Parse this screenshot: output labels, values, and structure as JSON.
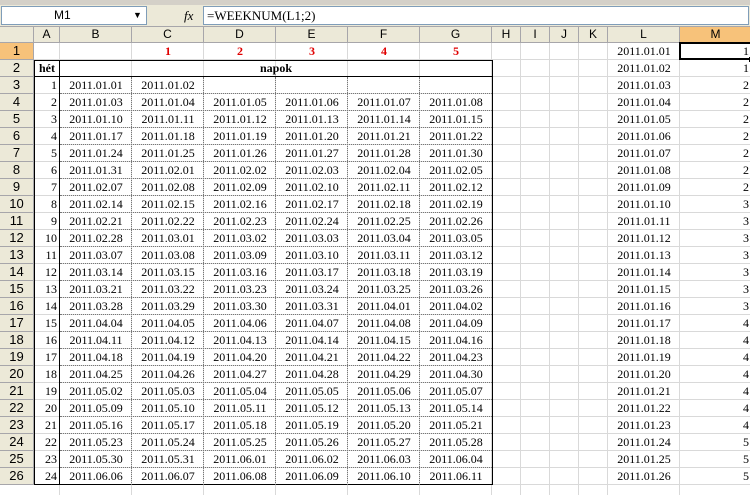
{
  "formula_bar": {
    "name_box": "M1",
    "fx_label": "fx",
    "formula": "=WEEKNUM(L1;2)"
  },
  "columns": [
    "A",
    "B",
    "C",
    "D",
    "E",
    "F",
    "G",
    "H",
    "I",
    "J",
    "K",
    "L",
    "M"
  ],
  "selected_cell": "M1",
  "row1_headers": {
    "C": "1",
    "D": "2",
    "E": "3",
    "F": "4",
    "G": "5"
  },
  "row2": {
    "A": "hét",
    "merged_label": "napok"
  },
  "rows": [
    {
      "row": 3,
      "A": "1",
      "B": "2011.01.01",
      "C": "2011.01.02",
      "D": "",
      "E": "",
      "F": "",
      "G": ""
    },
    {
      "row": 4,
      "A": "2",
      "B": "2011.01.03",
      "C": "2011.01.04",
      "D": "2011.01.05",
      "E": "2011.01.06",
      "F": "2011.01.07",
      "G": "2011.01.08"
    },
    {
      "row": 5,
      "A": "3",
      "B": "2011.01.10",
      "C": "2011.01.11",
      "D": "2011.01.12",
      "E": "2011.01.13",
      "F": "2011.01.14",
      "G": "2011.01.15"
    },
    {
      "row": 6,
      "A": "4",
      "B": "2011.01.17",
      "C": "2011.01.18",
      "D": "2011.01.19",
      "E": "2011.01.20",
      "F": "2011.01.21",
      "G": "2011.01.22"
    },
    {
      "row": 7,
      "A": "5",
      "B": "2011.01.24",
      "C": "2011.01.25",
      "D": "2011.01.26",
      "E": "2011.01.27",
      "F": "2011.01.28",
      "G": "2011.01.30"
    },
    {
      "row": 8,
      "A": "6",
      "B": "2011.01.31",
      "C": "2011.02.01",
      "D": "2011.02.02",
      "E": "2011.02.03",
      "F": "2011.02.04",
      "G": "2011.02.05"
    },
    {
      "row": 9,
      "A": "7",
      "B": "2011.02.07",
      "C": "2011.02.08",
      "D": "2011.02.09",
      "E": "2011.02.10",
      "F": "2011.02.11",
      "G": "2011.02.12"
    },
    {
      "row": 10,
      "A": "8",
      "B": "2011.02.14",
      "C": "2011.02.15",
      "D": "2011.02.16",
      "E": "2011.02.17",
      "F": "2011.02.18",
      "G": "2011.02.19"
    },
    {
      "row": 11,
      "A": "9",
      "B": "2011.02.21",
      "C": "2011.02.22",
      "D": "2011.02.23",
      "E": "2011.02.24",
      "F": "2011.02.25",
      "G": "2011.02.26"
    },
    {
      "row": 12,
      "A": "10",
      "B": "2011.02.28",
      "C": "2011.03.01",
      "D": "2011.03.02",
      "E": "2011.03.03",
      "F": "2011.03.04",
      "G": "2011.03.05"
    },
    {
      "row": 13,
      "A": "11",
      "B": "2011.03.07",
      "C": "2011.03.08",
      "D": "2011.03.09",
      "E": "2011.03.10",
      "F": "2011.03.11",
      "G": "2011.03.12"
    },
    {
      "row": 14,
      "A": "12",
      "B": "2011.03.14",
      "C": "2011.03.15",
      "D": "2011.03.16",
      "E": "2011.03.17",
      "F": "2011.03.18",
      "G": "2011.03.19"
    },
    {
      "row": 15,
      "A": "13",
      "B": "2011.03.21",
      "C": "2011.03.22",
      "D": "2011.03.23",
      "E": "2011.03.24",
      "F": "2011.03.25",
      "G": "2011.03.26"
    },
    {
      "row": 16,
      "A": "14",
      "B": "2011.03.28",
      "C": "2011.03.29",
      "D": "2011.03.30",
      "E": "2011.03.31",
      "F": "2011.04.01",
      "G": "2011.04.02"
    },
    {
      "row": 17,
      "A": "15",
      "B": "2011.04.04",
      "C": "2011.04.05",
      "D": "2011.04.06",
      "E": "2011.04.07",
      "F": "2011.04.08",
      "G": "2011.04.09"
    },
    {
      "row": 18,
      "A": "16",
      "B": "2011.04.11",
      "C": "2011.04.12",
      "D": "2011.04.13",
      "E": "2011.04.14",
      "F": "2011.04.15",
      "G": "2011.04.16"
    },
    {
      "row": 19,
      "A": "17",
      "B": "2011.04.18",
      "C": "2011.04.19",
      "D": "2011.04.20",
      "E": "2011.04.21",
      "F": "2011.04.22",
      "G": "2011.04.23"
    },
    {
      "row": 20,
      "A": "18",
      "B": "2011.04.25",
      "C": "2011.04.26",
      "D": "2011.04.27",
      "E": "2011.04.28",
      "F": "2011.04.29",
      "G": "2011.04.30"
    },
    {
      "row": 21,
      "A": "19",
      "B": "2011.05.02",
      "C": "2011.05.03",
      "D": "2011.05.04",
      "E": "2011.05.05",
      "F": "2011.05.06",
      "G": "2011.05.07"
    },
    {
      "row": 22,
      "A": "20",
      "B": "2011.05.09",
      "C": "2011.05.10",
      "D": "2011.05.11",
      "E": "2011.05.12",
      "F": "2011.05.13",
      "G": "2011.05.14"
    },
    {
      "row": 23,
      "A": "21",
      "B": "2011.05.16",
      "C": "2011.05.17",
      "D": "2011.05.18",
      "E": "2011.05.19",
      "F": "2011.05.20",
      "G": "2011.05.21"
    },
    {
      "row": 24,
      "A": "22",
      "B": "2011.05.23",
      "C": "2011.05.24",
      "D": "2011.05.25",
      "E": "2011.05.26",
      "F": "2011.05.27",
      "G": "2011.05.28"
    },
    {
      "row": 25,
      "A": "23",
      "B": "2011.05.30",
      "C": "2011.05.31",
      "D": "2011.06.01",
      "E": "2011.06.02",
      "F": "2011.06.03",
      "G": "2011.06.04"
    },
    {
      "row": 26,
      "A": "24",
      "B": "2011.06.06",
      "C": "2011.06.07",
      "D": "2011.06.08",
      "E": "2011.06.09",
      "F": "2011.06.10",
      "G": "2011.06.11"
    }
  ],
  "side_rows": [
    {
      "row": 1,
      "L": "2011.01.01",
      "M": "1"
    },
    {
      "row": 2,
      "L": "2011.01.02",
      "M": "1"
    },
    {
      "row": 3,
      "L": "2011.01.03",
      "M": "2"
    },
    {
      "row": 4,
      "L": "2011.01.04",
      "M": "2"
    },
    {
      "row": 5,
      "L": "2011.01.05",
      "M": "2"
    },
    {
      "row": 6,
      "L": "2011.01.06",
      "M": "2"
    },
    {
      "row": 7,
      "L": "2011.01.07",
      "M": "2"
    },
    {
      "row": 8,
      "L": "2011.01.08",
      "M": "2"
    },
    {
      "row": 9,
      "L": "2011.01.09",
      "M": "2"
    },
    {
      "row": 10,
      "L": "2011.01.10",
      "M": "3"
    },
    {
      "row": 11,
      "L": "2011.01.11",
      "M": "3"
    },
    {
      "row": 12,
      "L": "2011.01.12",
      "M": "3"
    },
    {
      "row": 13,
      "L": "2011.01.13",
      "M": "3"
    },
    {
      "row": 14,
      "L": "2011.01.14",
      "M": "3"
    },
    {
      "row": 15,
      "L": "2011.01.15",
      "M": "3"
    },
    {
      "row": 16,
      "L": "2011.01.16",
      "M": "3"
    },
    {
      "row": 17,
      "L": "2011.01.17",
      "M": "4"
    },
    {
      "row": 18,
      "L": "2011.01.18",
      "M": "4"
    },
    {
      "row": 19,
      "L": "2011.01.19",
      "M": "4"
    },
    {
      "row": 20,
      "L": "2011.01.20",
      "M": "4"
    },
    {
      "row": 21,
      "L": "2011.01.21",
      "M": "4"
    },
    {
      "row": 22,
      "L": "2011.01.22",
      "M": "4"
    },
    {
      "row": 23,
      "L": "2011.01.23",
      "M": "4"
    },
    {
      "row": 24,
      "L": "2011.01.24",
      "M": "5"
    },
    {
      "row": 25,
      "L": "2011.01.25",
      "M": "5"
    },
    {
      "row": 26,
      "L": "2011.01.26",
      "M": "5"
    }
  ],
  "colors": {
    "header_bg": "#ece9d8",
    "selected_header": "#f7c27a",
    "red_text": "#e00000",
    "gridline": "#d9d9d9"
  }
}
